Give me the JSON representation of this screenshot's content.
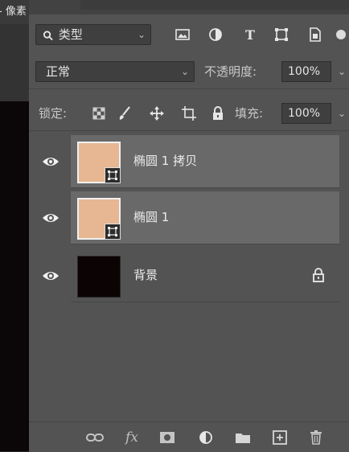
{
  "left_panel": {
    "tab_label": "- 像素"
  },
  "filter": {
    "kind_label": "类型",
    "filter_icons": [
      "image-filter-icon",
      "adjustment-filter-icon",
      "type-filter-icon",
      "shape-filter-icon",
      "smart-object-filter-icon"
    ]
  },
  "blend": {
    "mode": "正常",
    "opacity_label": "不透明度:",
    "opacity_value": "100%"
  },
  "lock": {
    "label": "锁定:",
    "fill_label": "填充:",
    "fill_value": "100%",
    "lock_icons": [
      "lock-transparent-pixels-icon",
      "lock-image-pixels-icon",
      "lock-position-icon",
      "lock-artboard-icon",
      "lock-all-icon"
    ]
  },
  "layers": [
    {
      "name": "椭圆 1 拷贝",
      "type": "shape",
      "selected": true,
      "visible": true,
      "thumb_color": "#e7b692"
    },
    {
      "name": "椭圆 1",
      "type": "shape",
      "selected": true,
      "visible": true,
      "thumb_color": "#e7b692"
    },
    {
      "name": "背景",
      "type": "background",
      "selected": false,
      "visible": true,
      "locked": true,
      "thumb_color": "#0b0304"
    }
  ],
  "bottom_icons": [
    "link-layers-icon",
    "fx-icon",
    "add-mask-icon",
    "adjustment-layer-icon",
    "group-folder-icon",
    "new-layer-icon",
    "trash-icon"
  ],
  "colors": {
    "panel_bg": "#535353",
    "selected_row": "#696969",
    "field_bg": "#3f3f3f"
  }
}
